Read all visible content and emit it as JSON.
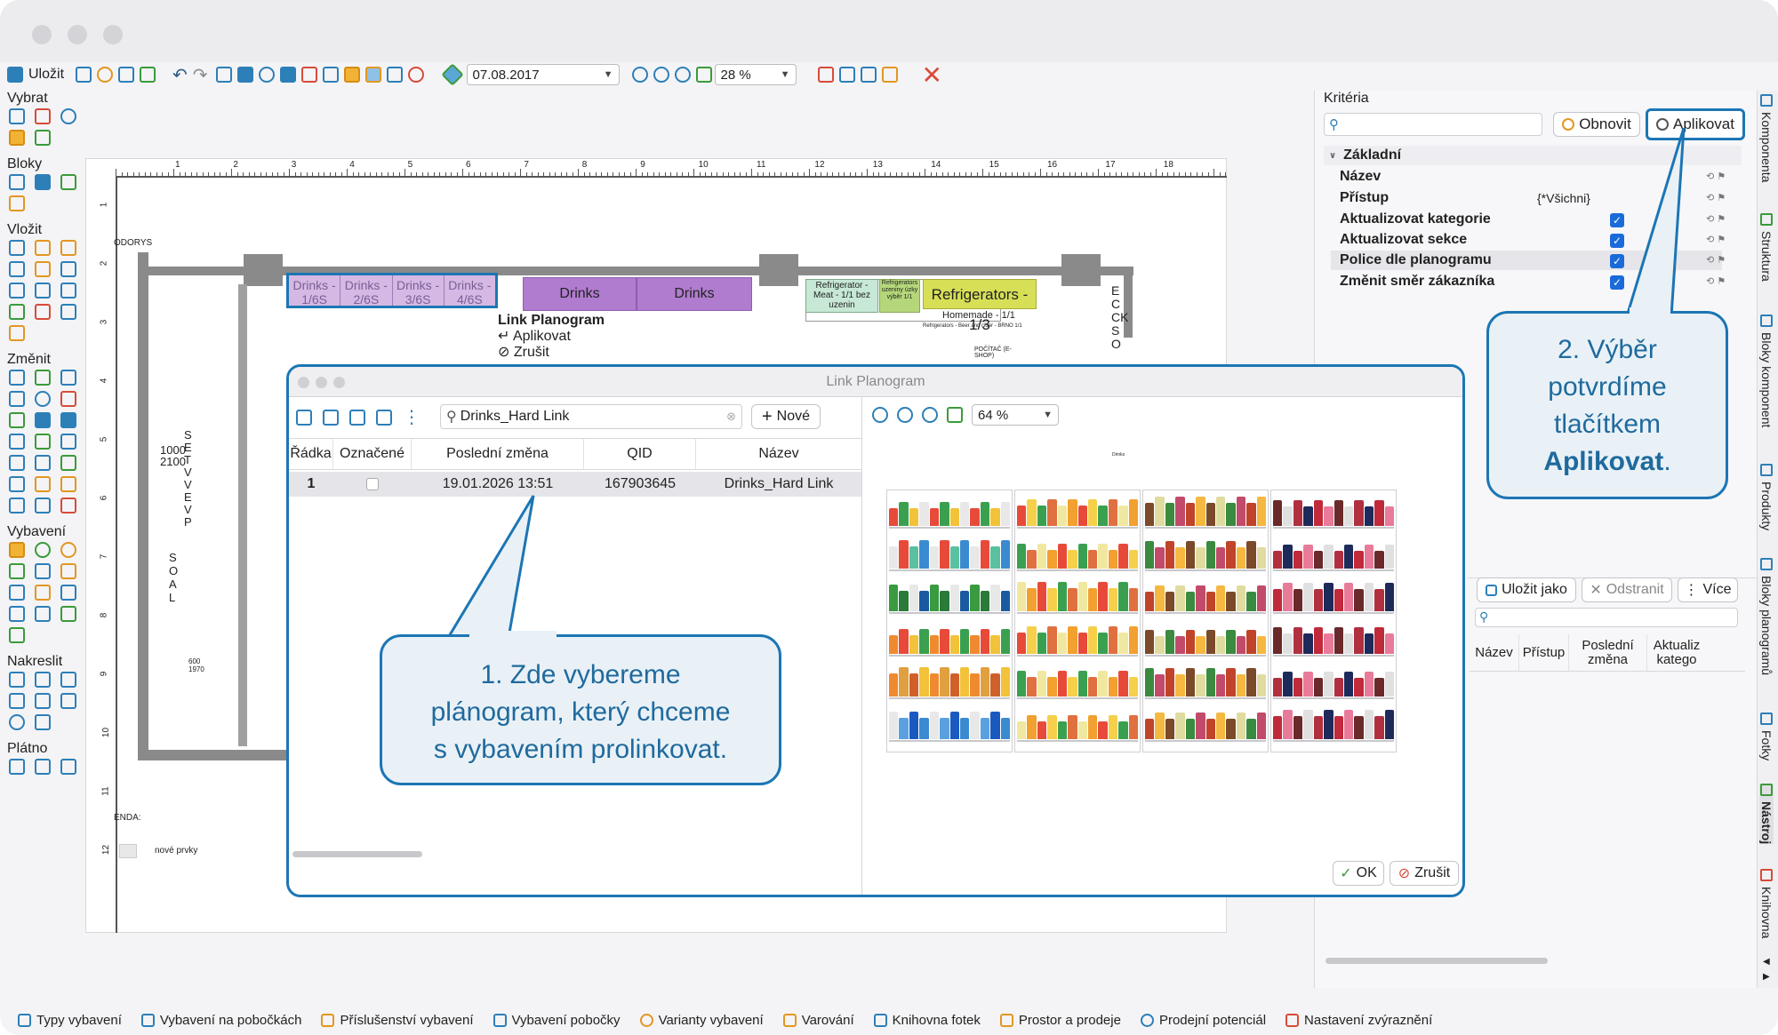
{
  "toolbar": {
    "save_label": "Uložit",
    "date_value": "07.08.2017",
    "zoom_value": "28 %"
  },
  "left_panel": {
    "sections": [
      "Vybrat",
      "Bloky",
      "Vložit",
      "Změnit",
      "Vybavení",
      "Nakreslit",
      "Plátno"
    ]
  },
  "canvas": {
    "ruler_numbers": [
      "1",
      "2",
      "3",
      "4",
      "5",
      "6",
      "7",
      "8",
      "9",
      "10",
      "11",
      "12",
      "13",
      "14",
      "15",
      "16",
      "17",
      "18"
    ],
    "ruler_v_numbers": [
      "1",
      "2",
      "3",
      "4",
      "5",
      "6",
      "7",
      "8",
      "9",
      "10",
      "11",
      "12"
    ],
    "labels": {
      "pudorys": "ODORYS",
      "legenda": "ENDA:",
      "nove": "nové prvky",
      "room": "1000 2100",
      "pocitac": "POČÍTAČ (E-SHOP)",
      "s_left": "SE TV VE VP",
      "s_bottom": "S O A L",
      "size_600": "600 1970"
    },
    "planograms": {
      "drinks_cells": [
        "Drinks - 1/6S",
        "Drinks - 2/6S",
        "Drinks - 3/6S",
        "Drinks - 4/6S"
      ],
      "drinks_big": [
        "Drinks",
        "Drinks"
      ],
      "fridge_meat": "Refrigerator - Meat - 1/1 bez uzenin",
      "fridge_small": "Refrigerators uzeniny úzky výběr 1/1",
      "fridge_big": "Refrigerators - 1/3",
      "homemade": "Homemade - 1/1",
      "refr_beer": "Refrigerators - Beer and cider - BRNO 1/1",
      "side_right": "E C CK SO"
    },
    "context_menu": {
      "title": "Link Planogram",
      "apply": "Aplikovat",
      "cancel": "Zrušit"
    }
  },
  "right_panel": {
    "criteria_title": "Kritéria",
    "refresh_label": "Obnovit",
    "apply_label": "Aplikovat",
    "group_label": "Základní",
    "rows": [
      {
        "label": "Název",
        "value": ""
      },
      {
        "label": "Přístup",
        "value": "{*Všichni}"
      },
      {
        "label": "Aktualizovat kategorie",
        "value": ""
      },
      {
        "label": "Aktualizovat sekce",
        "value": ""
      },
      {
        "label": "Police dle planogramu",
        "value": ""
      },
      {
        "label": "Změnit směr zákazníka",
        "value": ""
      }
    ],
    "lower": {
      "save_as": "Uložit jako",
      "remove": "Odstranit",
      "more": "Více",
      "columns": [
        "Název",
        "Přístup",
        "Poslední změna",
        "Aktualiz katego"
      ]
    }
  },
  "vertical_tabs": [
    "Komponenta",
    "Struktura",
    "Bloky komponent",
    "Produkty",
    "Bloky planogramů",
    "Fotky",
    "Nástroj",
    "Knihovna"
  ],
  "bottom_tabs": [
    "Typy vybavení",
    "Vybavení na pobočkách",
    "Příslušenství vybavení",
    "Vybavení pobočky",
    "Varianty vybavení",
    "Varování",
    "Knihovna fotek",
    "Prostor a prodeje",
    "Prodejní potenciál",
    "Nastavení zvýraznění"
  ],
  "dialog": {
    "title": "Link Planogram",
    "search_value": "Drinks_Hard Link",
    "new_label": "Nové",
    "zoom_value": "64 %",
    "columns": [
      "Řádka",
      "Označené",
      "Poslední změna",
      "QID",
      "Název"
    ],
    "rows": [
      {
        "row": "1",
        "marked": "",
        "changed": "19.01.2026 13:51",
        "qid": "167903645",
        "name": "Drinks_Hard Link"
      }
    ],
    "preview_label": "Drinks",
    "ok_label": "OK",
    "cancel_label": "Zrušit"
  },
  "callouts": {
    "one": [
      "1. Zde vybereme",
      "plánogram, který chceme",
      "s vybavením prolinkovat."
    ],
    "two_lines": [
      "2. Výběr",
      "potvrdíme",
      "tlačítkem"
    ],
    "two_bold": "Aplikovat",
    "two_end": "."
  },
  "colors": {
    "accent": "#1c76b4",
    "callout_bg": "#e9f1f7",
    "planogram_purple": "#b07ccf",
    "fridge_green": "#b5d77a",
    "fridge_yellow": "#e8e26c",
    "checkbox": "#1a6bd9",
    "close_red": "#d84b3a"
  }
}
